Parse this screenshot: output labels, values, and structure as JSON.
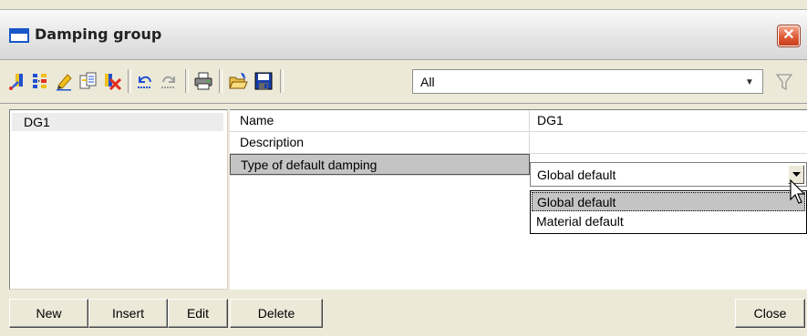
{
  "window": {
    "title": "Damping group",
    "close_symbol": "✕"
  },
  "toolbar": {
    "icons": [
      "new-record-icon",
      "insert-record-icon",
      "edit-icon",
      "copy-icon",
      "delete-icon",
      "undo-icon",
      "redo-icon",
      "print-icon",
      "open-icon",
      "save-icon",
      "funnel-icon"
    ],
    "filter_value": "All",
    "filter_arrow": "▼"
  },
  "list": {
    "items": [
      {
        "label": "DG1"
      }
    ]
  },
  "properties": {
    "rows": [
      {
        "name": "Name",
        "value": "DG1"
      },
      {
        "name": "Description",
        "value": ""
      },
      {
        "name": "Type of default damping",
        "value": "Global default"
      }
    ]
  },
  "dropdown": {
    "options": [
      "Global default",
      "Material default"
    ],
    "highlighted": "Global default"
  },
  "buttons": {
    "new": "New",
    "insert": "Insert",
    "edit": "Edit",
    "delete": "Delete",
    "close": "Close"
  },
  "colors": {
    "close_button": "#e05a36",
    "selection": "#c4c4c4",
    "accent_blue": "#1957c8"
  }
}
